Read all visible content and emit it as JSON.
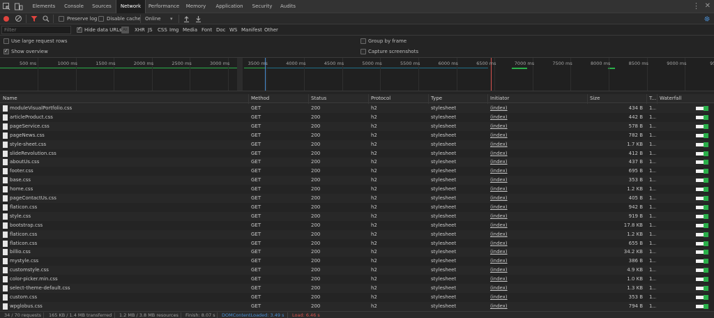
{
  "tabs": [
    "Elements",
    "Console",
    "Sources",
    "Network",
    "Performance",
    "Memory",
    "Application",
    "Security",
    "Audits"
  ],
  "active_tab": "Network",
  "toolbar": {
    "preserve_log": "Preserve log",
    "disable_cache": "Disable cache",
    "throttle": "Online",
    "throttle_arrow": "▾"
  },
  "filter": {
    "placeholder": "Filter",
    "hide_data_urls": "Hide data URLs",
    "all": "All",
    "types": [
      "XHR",
      "JS",
      "CSS",
      "Img",
      "Media",
      "Font",
      "Doc",
      "WS",
      "Manifest",
      "Other"
    ]
  },
  "options": {
    "large_rows": "Use large request rows",
    "show_overview": "Show overview",
    "group_by_frame": "Group by frame",
    "capture_screenshots": "Capture screenshots"
  },
  "overview": {
    "ticks": [
      "500 ms",
      "1000 ms",
      "1500 ms",
      "2000 ms",
      "2500 ms",
      "3000 ms",
      "3500 ms",
      "4000 ms",
      "4500 ms",
      "5000 ms",
      "5500 ms",
      "6000 ms",
      "6500 ms",
      "7000 ms",
      "7500 ms",
      "8000 ms",
      "8500 ms",
      "9000 ms",
      "9500"
    ]
  },
  "columns": {
    "name": "Name",
    "method": "Method",
    "status": "Status",
    "protocol": "Protocol",
    "type": "Type",
    "initiator": "Initiator",
    "size": "Size",
    "time": "T...",
    "waterfall": "Waterfall"
  },
  "rows": [
    {
      "name": "moduleVisualPortfolio.css",
      "method": "GET",
      "status": "200",
      "protocol": "h2",
      "type": "stylesheet",
      "initiator": "(index)",
      "size": "434 B",
      "time": "1..."
    },
    {
      "name": "articleProduct.css",
      "method": "GET",
      "status": "200",
      "protocol": "h2",
      "type": "stylesheet",
      "initiator": "(index)",
      "size": "442 B",
      "time": "1..."
    },
    {
      "name": "pageService.css",
      "method": "GET",
      "status": "200",
      "protocol": "h2",
      "type": "stylesheet",
      "initiator": "(index)",
      "size": "578 B",
      "time": "1..."
    },
    {
      "name": "pageNews.css",
      "method": "GET",
      "status": "200",
      "protocol": "h2",
      "type": "stylesheet",
      "initiator": "(index)",
      "size": "782 B",
      "time": "1..."
    },
    {
      "name": "style-sheet.css",
      "method": "GET",
      "status": "200",
      "protocol": "h2",
      "type": "stylesheet",
      "initiator": "(index)",
      "size": "1.7 KB",
      "time": "1..."
    },
    {
      "name": "slideRevolution.css",
      "method": "GET",
      "status": "200",
      "protocol": "h2",
      "type": "stylesheet",
      "initiator": "(index)",
      "size": "412 B",
      "time": "1..."
    },
    {
      "name": "aboutUs.css",
      "method": "GET",
      "status": "200",
      "protocol": "h2",
      "type": "stylesheet",
      "initiator": "(index)",
      "size": "437 B",
      "time": "1..."
    },
    {
      "name": "footer.css",
      "method": "GET",
      "status": "200",
      "protocol": "h2",
      "type": "stylesheet",
      "initiator": "(index)",
      "size": "695 B",
      "time": "1..."
    },
    {
      "name": "base.css",
      "method": "GET",
      "status": "200",
      "protocol": "h2",
      "type": "stylesheet",
      "initiator": "(index)",
      "size": "353 B",
      "time": "1..."
    },
    {
      "name": "home.css",
      "method": "GET",
      "status": "200",
      "protocol": "h2",
      "type": "stylesheet",
      "initiator": "(index)",
      "size": "1.2 KB",
      "time": "1..."
    },
    {
      "name": "pageContactUs.css",
      "method": "GET",
      "status": "200",
      "protocol": "h2",
      "type": "stylesheet",
      "initiator": "(index)",
      "size": "405 B",
      "time": "1..."
    },
    {
      "name": "flaticon.css",
      "method": "GET",
      "status": "200",
      "protocol": "h2",
      "type": "stylesheet",
      "initiator": "(index)",
      "size": "942 B",
      "time": "1..."
    },
    {
      "name": "style.css",
      "method": "GET",
      "status": "200",
      "protocol": "h2",
      "type": "stylesheet",
      "initiator": "(index)",
      "size": "919 B",
      "time": "1..."
    },
    {
      "name": "bootstrap.css",
      "method": "GET",
      "status": "200",
      "protocol": "h2",
      "type": "stylesheet",
      "initiator": "(index)",
      "size": "17.8 KB",
      "time": "1..."
    },
    {
      "name": "flaticon.css",
      "method": "GET",
      "status": "200",
      "protocol": "h2",
      "type": "stylesheet",
      "initiator": "(index)",
      "size": "1.2 KB",
      "time": "1..."
    },
    {
      "name": "flaticon.css",
      "method": "GET",
      "status": "200",
      "protocol": "h2",
      "type": "stylesheet",
      "initiator": "(index)",
      "size": "655 B",
      "time": "1..."
    },
    {
      "name": "billio.css",
      "method": "GET",
      "status": "200",
      "protocol": "h2",
      "type": "stylesheet",
      "initiator": "(index)",
      "size": "34.2 KB",
      "time": "1..."
    },
    {
      "name": "mystyle.css",
      "method": "GET",
      "status": "200",
      "protocol": "h2",
      "type": "stylesheet",
      "initiator": "(index)",
      "size": "386 B",
      "time": "1..."
    },
    {
      "name": "customstyle.css",
      "method": "GET",
      "status": "200",
      "protocol": "h2",
      "type": "stylesheet",
      "initiator": "(index)",
      "size": "4.9 KB",
      "time": "1..."
    },
    {
      "name": "color-picker.min.css",
      "method": "GET",
      "status": "200",
      "protocol": "h2",
      "type": "stylesheet",
      "initiator": "(index)",
      "size": "1.0 KB",
      "time": "1..."
    },
    {
      "name": "select-theme-default.css",
      "method": "GET",
      "status": "200",
      "protocol": "h2",
      "type": "stylesheet",
      "initiator": "(index)",
      "size": "1.3 KB",
      "time": "1..."
    },
    {
      "name": "custom.css",
      "method": "GET",
      "status": "200",
      "protocol": "h2",
      "type": "stylesheet",
      "initiator": "(index)",
      "size": "353 B",
      "time": "1..."
    },
    {
      "name": "wpglobus.css",
      "method": "GET",
      "status": "200",
      "protocol": "h2",
      "type": "stylesheet",
      "initiator": "(index)",
      "size": "794 B",
      "time": "1..."
    }
  ],
  "status_bar": {
    "requests": "34 / 70 requests",
    "transferred": "165 KB / 1.4 MB transferred",
    "resources": "1.2 MB / 3.8 MB resources",
    "finish": "Finish: 8.07 s",
    "dom_content_loaded": "DOMContentLoaded: 3.49 s",
    "load": "Load: 6.46 s"
  },
  "colors": {
    "record": "#e0443e",
    "filter_icon": "#e0443e",
    "dom_content_loaded": "#4a8fd4",
    "load": "#d9534f",
    "waterfall_download": "#2ab04a",
    "settings_gear": "#4a8fd4"
  }
}
